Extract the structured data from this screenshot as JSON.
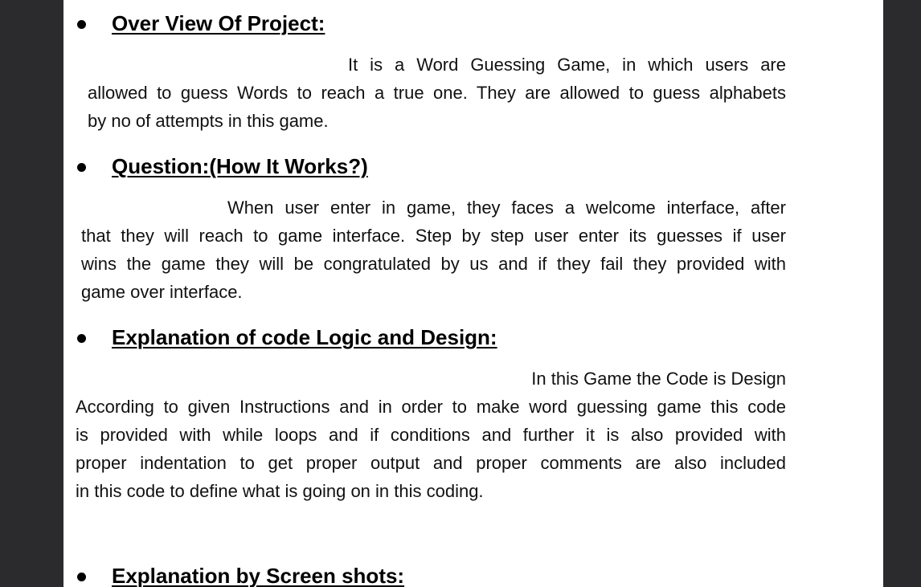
{
  "document": {
    "sections": [
      {
        "heading": "Over View Of Project:",
        "lines": [
          "It is a Word Guessing Game, in which users are",
          "allowed to guess Words to reach a true one. They are allowed to guess alphabets",
          "by no of attempts in this game."
        ]
      },
      {
        "heading": "Question:(How It Works?)",
        "lines": [
          "When user enter in game, they faces a welcome interface, after",
          "that they will reach to game interface. Step by step user enter its guesses if user",
          "wins the game they will be congratulated by us and if they fail they provided with",
          "game over interface."
        ]
      },
      {
        "heading": "Explanation of code Logic and Design:",
        "lines": [
          "In this Game the Code is Design",
          "According to given Instructions and in order to make word guessing game this code",
          "is provided with while loops and if conditions and further it is also provided with",
          "proper indentation to get proper output and proper comments are also included",
          "in this code to define what is going on in this coding."
        ]
      },
      {
        "heading": "Explanation by Screen shots:",
        "lines": []
      }
    ]
  },
  "colors": {
    "viewer_background": "#2b2b2e",
    "page_background": "#ffffff",
    "text": "#111111"
  }
}
